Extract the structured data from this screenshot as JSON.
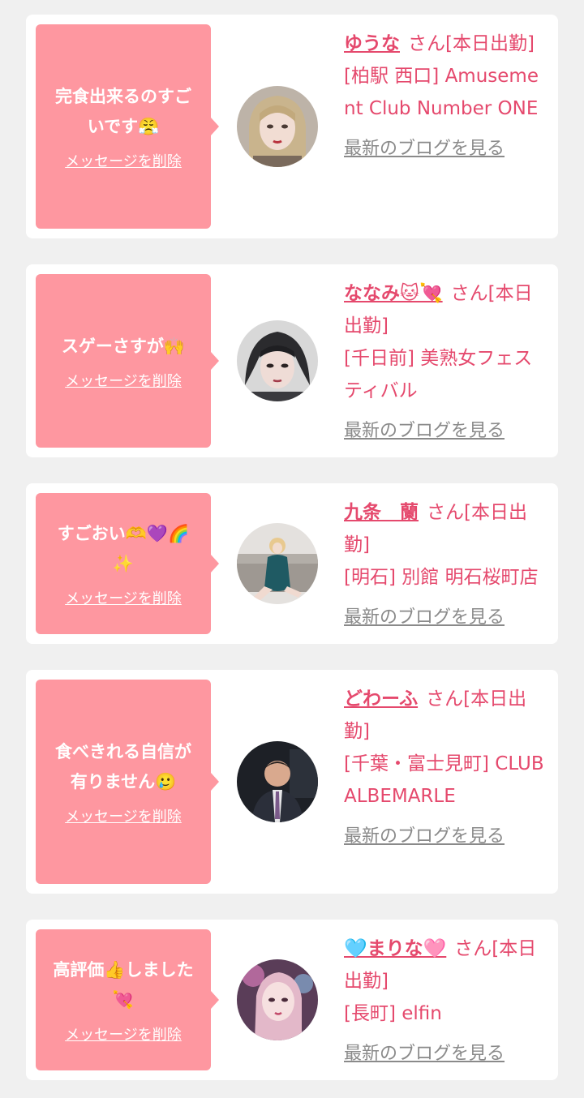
{
  "colors": {
    "accent": "#e5496d",
    "bubble": "#fe97a0",
    "background": "#f0f0f0",
    "link_gray": "#8a8a8a"
  },
  "cards": [
    {
      "message": "完食出来るのすごいです😤",
      "delete_label": "メッセージを削除",
      "name": "ゆうな",
      "suffix": "さん[本日出勤]",
      "shop": "[柏駅 西口] Amusement Club Number ONE",
      "blog_label": "最新のブログを見る",
      "avatar_icon": "woman-blonde-photo"
    },
    {
      "message": "スゲーさすが🙌",
      "delete_label": "メッセージを削除",
      "name": "ななみ🐱💘",
      "suffix": "さん[本日出勤]",
      "shop": "[千日前] 美熟女フェスティバル",
      "blog_label": "最新のブログを見る",
      "avatar_icon": "woman-dark-hair-photo"
    },
    {
      "message": "すごおい🫶💜🌈✨",
      "delete_label": "メッセージを削除",
      "name": "九条　蘭",
      "suffix": "さん[本日出勤]",
      "shop": "[明石] 別館 明石桜町店",
      "blog_label": "最新のブログを見る",
      "avatar_icon": "woman-sofa-photo"
    },
    {
      "message": "食べきれる自信が有りません🥲",
      "delete_label": "メッセージを削除",
      "name": "どわーふ",
      "suffix": "さん[本日出勤]",
      "shop": "[千葉・富士見町] CLUB ALBEMARLE",
      "blog_label": "最新のブログを見る",
      "avatar_icon": "man-suit-photo"
    },
    {
      "message": "高評価👍しました💘",
      "delete_label": "メッセージを削除",
      "name": "🩵まりな🩷",
      "suffix": "さん[本日出勤]",
      "shop": "[長町] elfin",
      "blog_label": "最新のブログを見る",
      "avatar_icon": "woman-pink-light-photo"
    }
  ]
}
